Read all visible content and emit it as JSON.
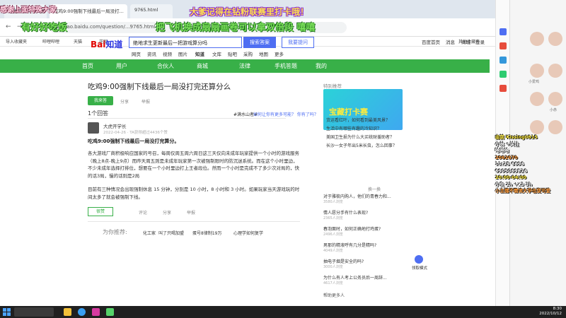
{
  "browser": {
    "tabs": [
      "感谢上面特殊大家",
      "吃鸡9:00强制下线最后一局没打...",
      "9765.html"
    ],
    "url": "zhidao.baidu.com/question/...9765.html",
    "bookmarks": [
      "导入收藏夹",
      "哔哩哔哩",
      "天猫",
      "花呗",
      "其他收藏夹"
    ]
  },
  "overlays": {
    "left": "感谢上面特殊大家",
    "center": "大爹记得在钻粉联赛里打卡哦！",
    "green_left": "有好好吃饭",
    "green_right": "把飞机换成扇扇画卷可以拿双倍段 嘻嘻"
  },
  "baidu": {
    "logo_a": "Bai",
    "logo_b": "知道",
    "search_value": "绝地求生更新最后一把游戏算分吗",
    "search_btn": "搜索答案",
    "ask_btn": "我要提问",
    "top_links": [
      "百度首页",
      "消息",
      "商城",
      "登录"
    ],
    "subnav": [
      "网页",
      "资讯",
      "视频",
      "图片",
      "知道",
      "文库",
      "贴吧",
      "采购",
      "地图",
      "更多"
    ],
    "green_nav": [
      "首页",
      "用户",
      "合伙人",
      "商城",
      "法律",
      "手机答题",
      "我的"
    ]
  },
  "question": {
    "title": "吃鸡9:00强制下线最后一局没打完还算分么",
    "answer_btn": "我来答",
    "share": "分享",
    "report": "举报",
    "answer_count": "1个回答",
    "answer_tag": "#满水山者#",
    "answer_tag2": "如何让你有更多可能？ 你有了吗？",
    "author": "大虎开学长",
    "date": "2022-04-26 · TA获得超过4436个赞",
    "answer_headline": "吃鸡9:00强制下线最后一局没打完算分。",
    "answer_p1": "各大游戏厂商积极响应国家的号召，每周仅周五周六周日这三天仅向未成年玩家提供一个小时的游戏服务（晚上8点-晚上9点）而昨天周五则是未成年玩家第一次被强制限时的防沉迷系统。而在这个小时里边，不少未成年选择打排位，想要在一个小时里边打上王者段位。然而一个小时是完成不了多少次对局的，快的话3局，慢的话则是2局",
    "answer_p2": "目前有三种情况会出现强制休息 15 分钟，分别是 10 小时，8 小时和 3 小时。如果玩家当天游戏玩的时间太多了就会被强制下线。",
    "like_btn": "很赞",
    "actions": [
      "评论",
      "分享",
      "举报"
    ],
    "recommend_label": "为你推荐:",
    "recommend": [
      "化工家",
      "叫了只喝加盟",
      "蛋号8律制19万",
      "心理学如何复学"
    ]
  },
  "right": {
    "title": "特别推荐",
    "banner_text": "宝藏打卡赛",
    "list": [
      "货运看红叶，如何看到最美风景？",
      "生活中有哪些有趣的冷知识？",
      "美国卫生损为什么大买统财援助者？",
      "长沙一女子年出5米长虫，怎么回事？"
    ],
    "hot_title": "换一换",
    "questions": [
      "对于雅梳内购人，他们的青春力和...",
      "情人愿分手有什么表现?",
      "春泡面时，如何正确地打鸡蛋?",
      "男那的精液呼有几分是精吗?",
      "抽电子烟是安全的吗?",
      "为什么有人考上公务员后一周辞..."
    ],
    "meta": [
      "3580人浏览",
      "2365人浏览",
      "2496人浏览",
      "4049人浏览",
      "3000人浏览",
      "4617人浏览"
    ],
    "help_more": "帮助更多人",
    "float_label": "领取模式"
  },
  "stream": {
    "chat": [
      "由前 Kissing0815",
      "小林 +关注",
      "哈哈哈",
      "2062670",
      "11:25 6696",
      "6905069826",
      "20:00-04:00",
      "小生 2h  +x3 3h",
      "小主播不需读大学也变可爱"
    ],
    "chat_names": [
      "小爱鸡",
      "小赤",
      "小梦"
    ]
  },
  "taskbar": {
    "time": "8:30",
    "date": "2022/10/12"
  }
}
